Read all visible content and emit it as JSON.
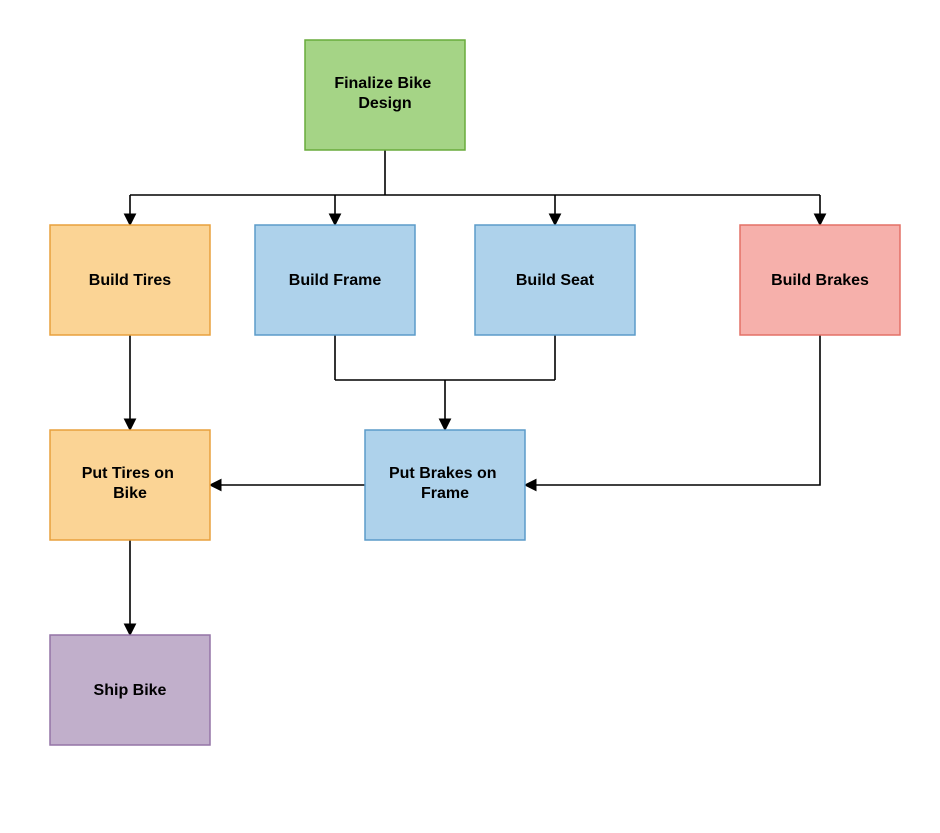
{
  "diagram": {
    "type": "flowchart",
    "nodes": {
      "finalize": {
        "label": "Finalize Bike Design",
        "fill": "#A5D486",
        "stroke": "#68AB3B"
      },
      "build_tires": {
        "label": "Build Tires",
        "fill": "#FBD495",
        "stroke": "#E8A03D"
      },
      "build_frame": {
        "label": "Build Frame",
        "fill": "#AED2EB",
        "stroke": "#5C9BC9"
      },
      "build_seat": {
        "label": "Build Seat",
        "fill": "#AED2EB",
        "stroke": "#5C9BC9"
      },
      "build_brakes": {
        "label": "Build Brakes",
        "fill": "#F6B0AB",
        "stroke": "#E37066"
      },
      "put_brakes": {
        "label": "Put Brakes on Frame",
        "fill": "#AED2EB",
        "stroke": "#5C9BC9"
      },
      "put_tires": {
        "label": "Put Tires on Bike",
        "fill": "#FBD495",
        "stroke": "#E8A03D"
      },
      "ship_bike": {
        "label": "Ship Bike",
        "fill": "#C1AFCB",
        "stroke": "#9474A6"
      }
    },
    "edges": [
      [
        "finalize",
        "build_tires"
      ],
      [
        "finalize",
        "build_frame"
      ],
      [
        "finalize",
        "build_seat"
      ],
      [
        "finalize",
        "build_brakes"
      ],
      [
        "build_tires",
        "put_tires"
      ],
      [
        "build_frame",
        "put_brakes"
      ],
      [
        "build_seat",
        "put_brakes"
      ],
      [
        "build_brakes",
        "put_brakes"
      ],
      [
        "put_brakes",
        "put_tires"
      ],
      [
        "put_tires",
        "ship_bike"
      ]
    ]
  }
}
